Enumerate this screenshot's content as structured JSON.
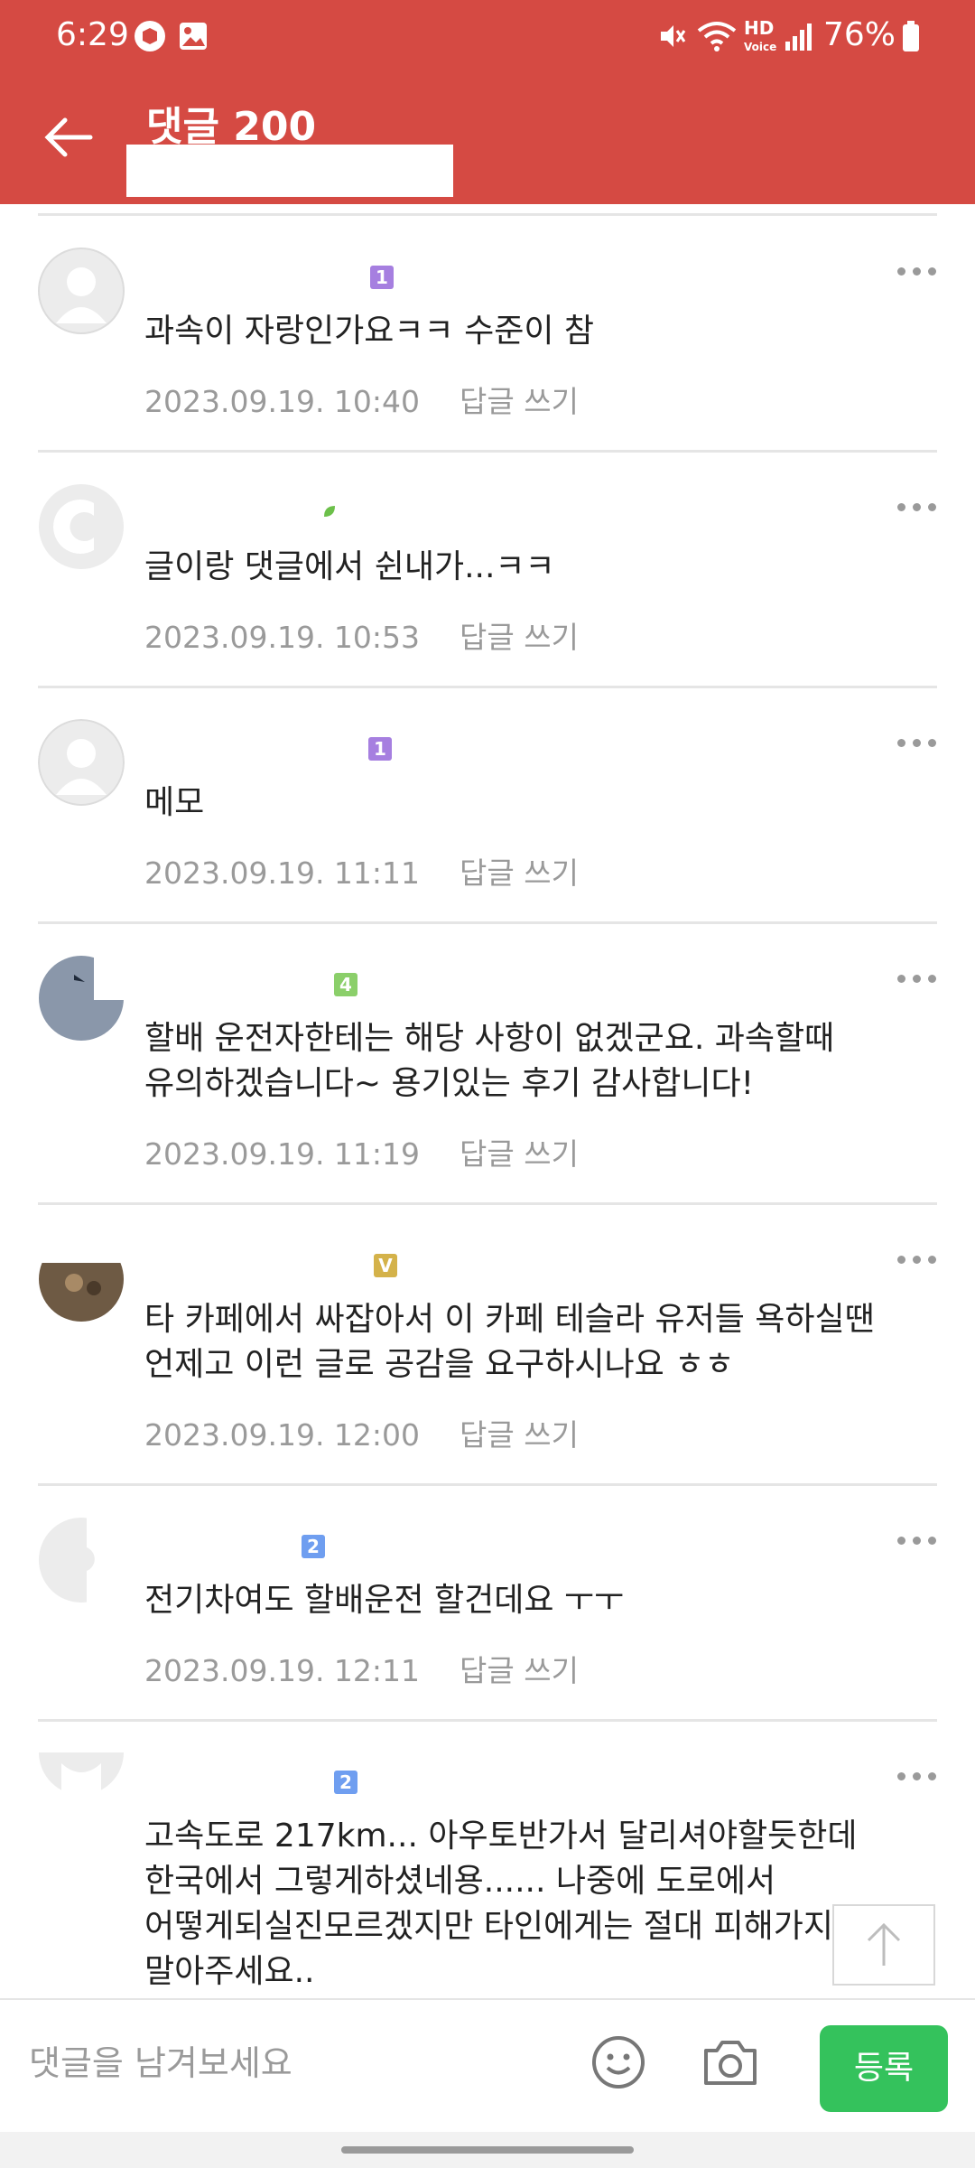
{
  "status_bar": {
    "time": "6:29",
    "battery": "76%",
    "hd_label": "HD",
    "voice_label": "Voice",
    "icons": [
      "app-icon",
      "gallery-icon",
      "mute-icon",
      "wifi-icon",
      "hd-voice-icon",
      "signal-icon",
      "battery-icon"
    ]
  },
  "header": {
    "title": "댓글 200",
    "back_icon": "arrow-left-icon"
  },
  "comments": [
    {
      "badge": "1",
      "badge_color": "#a67fe0",
      "text": "과속이 자랑인가요ㅋㅋ 수준이 참",
      "date": "2023.09.19. 10:40",
      "reply": "답글 쓰기"
    },
    {
      "badge": "",
      "badge_color": "#6cc04a",
      "text": "글이랑 댓글에서 쉰내가...ㅋㅋ",
      "date": "2023.09.19. 10:53",
      "reply": "답글 쓰기"
    },
    {
      "badge": "1",
      "badge_color": "#a67fe0",
      "text": "메모",
      "date": "2023.09.19. 11:11",
      "reply": "답글 쓰기"
    },
    {
      "badge": "4",
      "badge_color": "#8bcf6a",
      "text": "할배 운전자한테는 해당 사항이 없겠군요. 과속할때\n유의하겠습니다~ 용기있는 후기 감사합니다!",
      "date": "2023.09.19. 11:19",
      "reply": "답글 쓰기"
    },
    {
      "badge": "V",
      "badge_color": "#d4b24a",
      "text": "타 카페에서 싸잡아서 이 카페 테슬라 유저들 욕하실땐\n언제고 이런 글로 공감을 요구하시나요 ㅎㅎ",
      "date": "2023.09.19. 12:00",
      "reply": "답글 쓰기"
    },
    {
      "badge": "2",
      "badge_color": "#6f9ef0",
      "text": "전기차여도 할배운전 할건데요 ㅜㅜ",
      "date": "2023.09.19. 12:11",
      "reply": "답글 쓰기"
    },
    {
      "badge": "2",
      "badge_color": "#6f9ef0",
      "text": "고속도로 217km... 아우토반가서 달리셔야할듯한데\n한국에서 그렇게하셨네용...... 나중에 도로에서\n어떻게되실진모르겠지만 타인에게는 절대 피해가지\n말아주세요..",
      "date": "",
      "reply": ""
    }
  ],
  "input_bar": {
    "placeholder": "댓글을 남겨보세요",
    "submit_label": "등록",
    "emoji_icon": "smiley-icon",
    "camera_icon": "camera-icon",
    "submit_color": "#34c25c"
  },
  "colors": {
    "header_bg": "#d54a43",
    "meta_text": "#9a9a9a"
  }
}
